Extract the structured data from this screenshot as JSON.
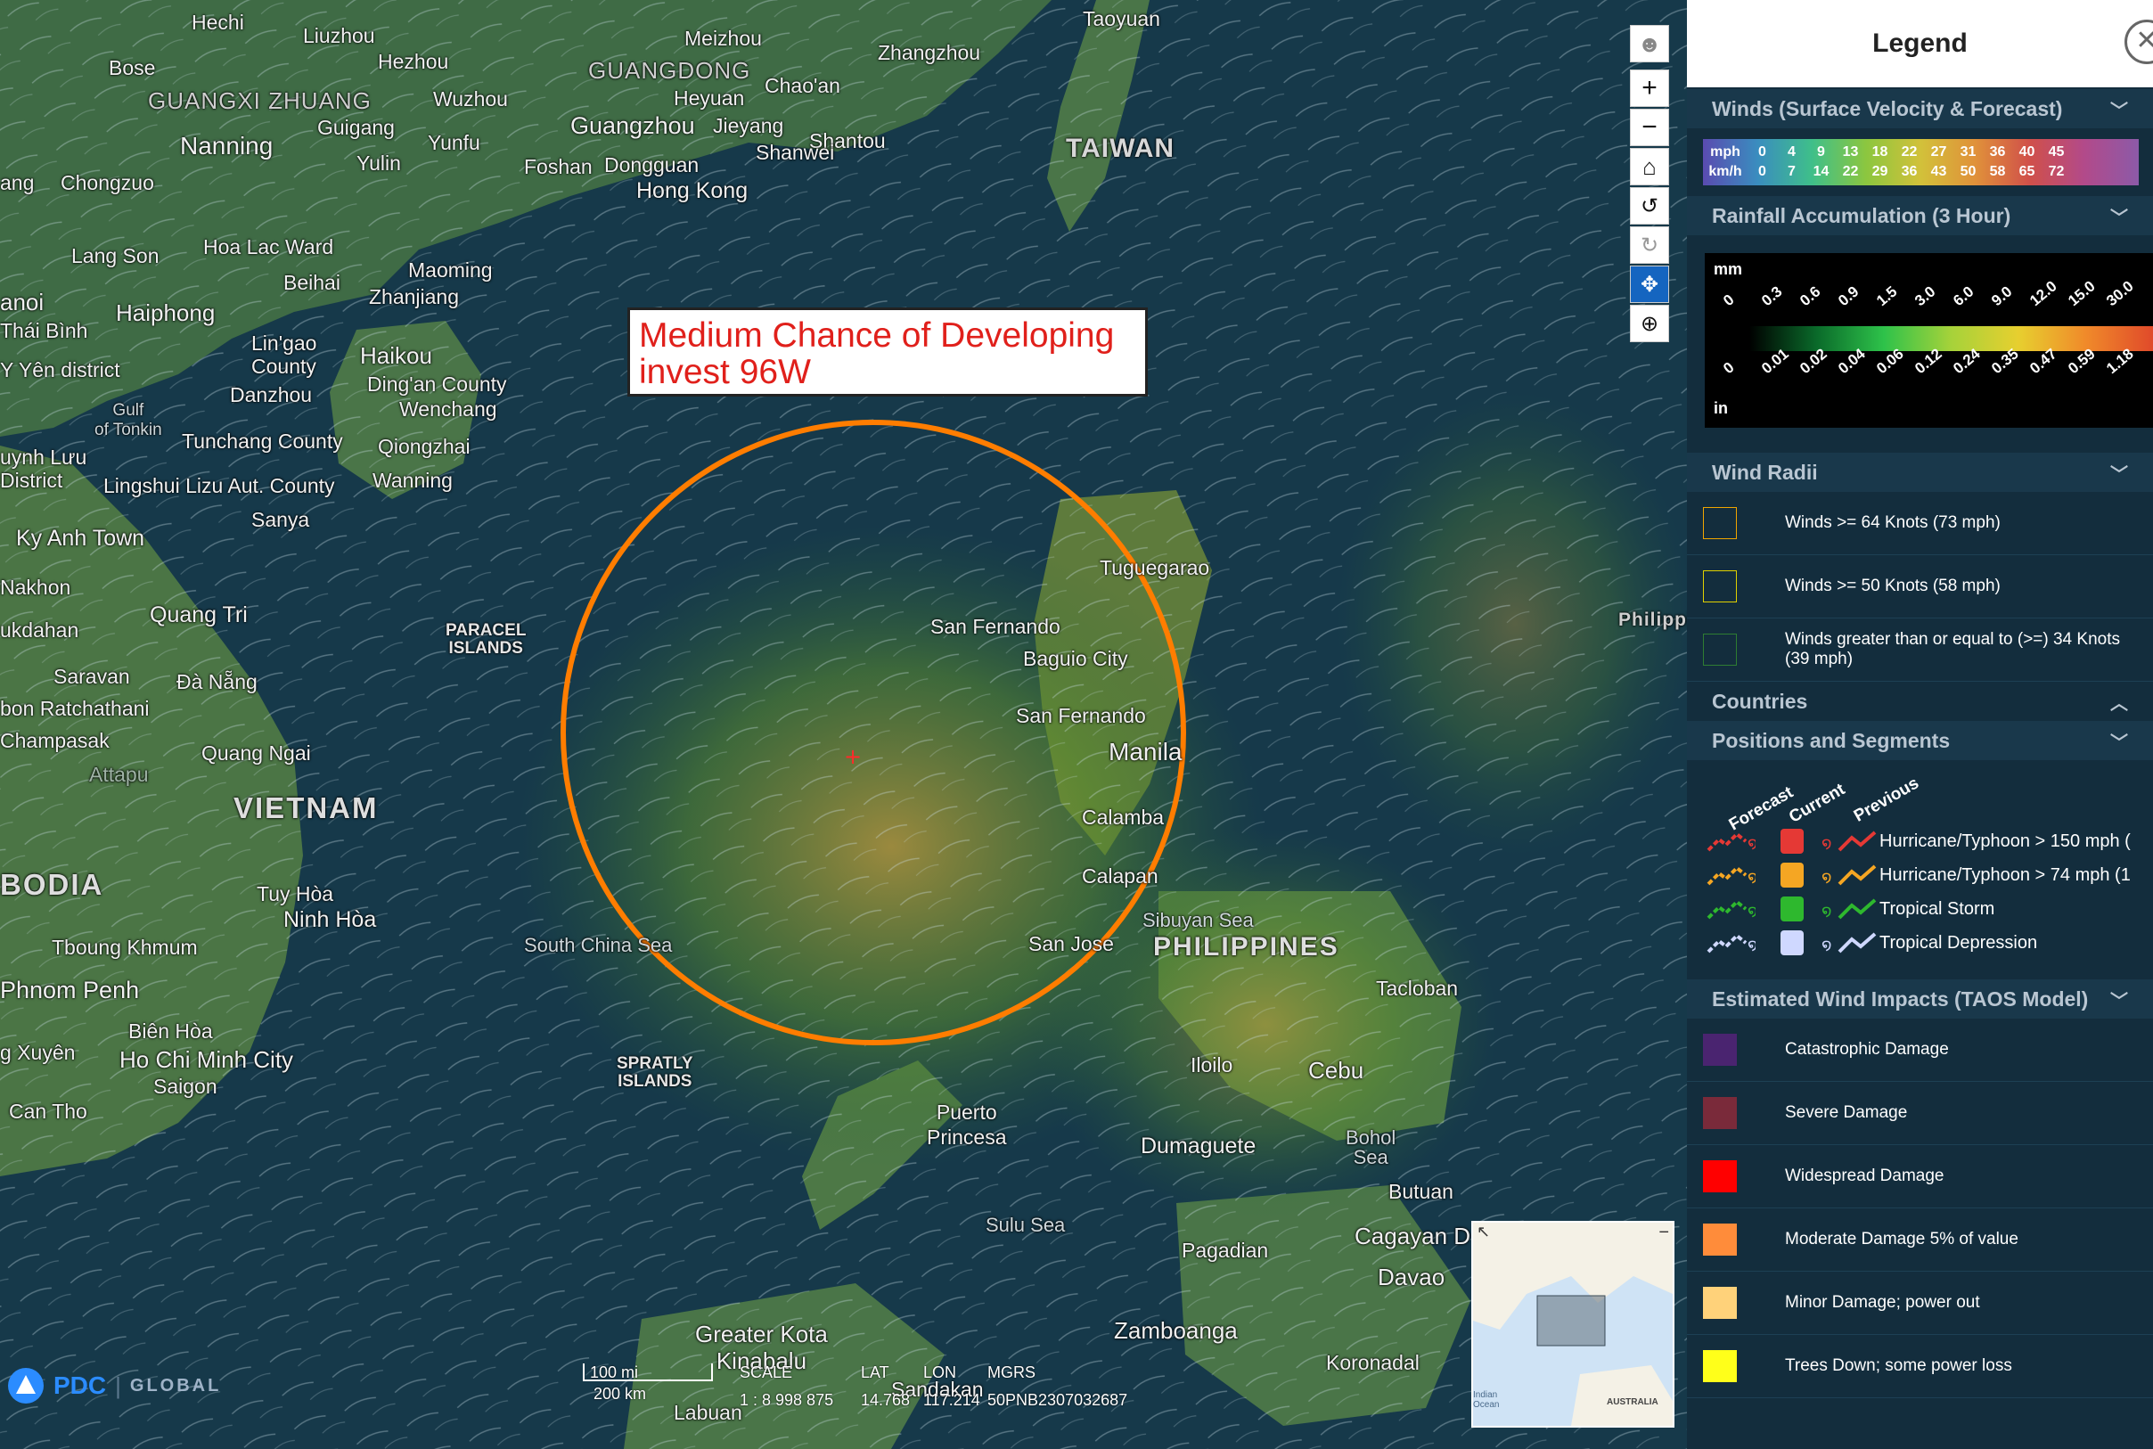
{
  "map": {
    "annotation": "Medium Chance of Developing\ninvest 96W",
    "labels": {
      "hechi": "Hechi",
      "liuzhou": "Liuzhou",
      "meizhou": "Meizhou",
      "zhangzhou": "Zhangzhou",
      "taoyuan": "Taoyuan",
      "bose": "Bose",
      "hezhou": "Hezhou",
      "guangdong": "GUANGDONG",
      "guangxi": "GUANGXI ZHUANG",
      "wuzhou": "Wuzhou",
      "heyuan": "Heyuan",
      "chaoan": "Chao'an",
      "nanning": "Nanning",
      "guigang": "Guigang",
      "yunfu": "Yunfu",
      "guangzhou": "Guangzhou",
      "jieyang": "Jieyang",
      "shantou": "Shantou",
      "shanwei": "Shanwei",
      "yulin": "Yulin",
      "foshan": "Foshan",
      "dongguan": "Dongguan",
      "hongkong": "Hong Kong",
      "taiwan": "TAIWAN",
      "chongzuo": "Chongzuo",
      "ang": "ang",
      "langson": "Lang Son",
      "hoalac": "Hoa Lac Ward",
      "beihai": "Beihai",
      "maoming": "Maoming",
      "zhanjiang": "Zhanjiang",
      "hanoi": "anoi",
      "haiphong": "Haiphong",
      "thaibinh": "Thái Bình",
      "lingao": "Lin'gao\nCounty",
      "haikou": "Haikou",
      "yenen": "Y Yên district",
      "danzhou": "Danzhou",
      "dingan": "Ding'an County",
      "wenchang": "Wenchang",
      "gulf": "Gulf\nof Tonkin",
      "tunchang": "Tunchang County",
      "qiongzhai": "Qiongzhai",
      "luu": "uynh Lưu\nDistrict",
      "lingshui": "Lingshui Lizu Aut. County",
      "wanning": "Wanning",
      "sanya": "Sanya",
      "kyanh": "Ky Anh Town",
      "nakhon": "Nakhon",
      "quangtri": "Quang Tri",
      "paracel": "PARACEL\nISLANDS",
      "mukdahan": "ukdahan",
      "savan": "Saravan",
      "danang": "Đà Nẵng",
      "ratchathani": "bon Ratchathani",
      "champasak": "Champasak",
      "quangngai": "Quang Ngai",
      "attapu": "Attapu",
      "vietnam": "VIETNAM",
      "cambodia": "BODIA",
      "tuyhoa": "Tuy Hòa",
      "ninhhoa": "Ninh Hòa",
      "tboung": "Tboung Khmum",
      "phnompenh": "Phnom Penh",
      "bienhoa": "Biên Hòa",
      "hcmc": "Ho Chi Minh City",
      "saigon": "Saigon",
      "xuyen": "g Xuyên",
      "cantho": "Can Tho",
      "southchinasea": "South China Sea",
      "spratly": "SPRATLY\nISLANDS",
      "tuguegarao": "Tuguegarao",
      "sanfernando1": "San Fernando",
      "baguio": "Baguio City",
      "sanfernando2": "San Fernando",
      "manila": "Manila",
      "calamba": "Calamba",
      "calapan": "Calapan",
      "sibuyan": "Sibuyan Sea",
      "philippines": "PHILIPPINES",
      "philippi": "Philippi",
      "sanjose": "San Jose",
      "tacloban": "Tacloban",
      "iloilo": "Iloilo",
      "cebu": "Cebu",
      "puerto": "Puerto\nPrincesa",
      "dumaguete": "Dumaguete",
      "bohol": "Bohol\nSea",
      "butuan": "Butuan",
      "cagayan": "Cagayan D",
      "sulusea": "Sulu Sea",
      "pagadian": "Pagadian",
      "davao": "Davao",
      "zamboanga": "Zamboanga",
      "greaterkota": "Greater Kota\nKinabalu",
      "sandakan": "Sandakan",
      "koronadal": "Koronadal",
      "labuan": "Labuan"
    },
    "scale": {
      "mi": "100 mi",
      "km": "200 km"
    },
    "coord": {
      "headers": [
        "SCALE",
        "LAT",
        "LON",
        "MGRS"
      ],
      "values": [
        "1 : 8 998 875",
        "14.768",
        "117.214",
        "50PNB2307032687"
      ]
    },
    "logo": {
      "pdc": "PDC",
      "global": "GLOBAL"
    },
    "inset": {
      "ocean": "Indian\nOcean",
      "australia": "AUSTRALIA"
    }
  },
  "legend": {
    "title": "Legend",
    "sections": {
      "winds": "Winds (Surface Velocity & Forecast)",
      "rain": "Rainfall Accumulation (3 Hour)",
      "radii": "Wind Radii",
      "countries": "Countries",
      "positions": "Positions and Segments",
      "impacts": "Estimated Wind Impacts (TAOS Model)"
    },
    "wind_table": {
      "mph_label": "mph",
      "kmh_label": "km/h",
      "mph": [
        "0",
        "4",
        "9",
        "13",
        "18",
        "22",
        "27",
        "31",
        "36",
        "40",
        "45"
      ],
      "kmh": [
        "0",
        "7",
        "14",
        "22",
        "29",
        "36",
        "43",
        "50",
        "58",
        "65",
        "72"
      ]
    },
    "rain": {
      "mm_label": "mm",
      "in_label": "in",
      "mm": [
        "0",
        "0.3",
        "0.6",
        "0.9",
        "1.5",
        "3.0",
        "6.0",
        "9.0",
        "12.0",
        "15.0",
        "30.0"
      ],
      "in": [
        "0",
        "0.01",
        "0.02",
        "0.04",
        "0.06",
        "0.12",
        "0.24",
        "0.35",
        "0.47",
        "0.59",
        "1.18"
      ]
    },
    "radii": [
      {
        "label": "Winds >= 64 Knots (73 mph)",
        "color": "#f0a500"
      },
      {
        "label": "Winds >= 50 Knots (58 mph)",
        "color": "#e0d000"
      },
      {
        "label": "Winds greater than or equal to (>=) 34 Knots (39 mph)",
        "color": "#2e7d32"
      }
    ],
    "positions": {
      "headers": [
        "Forecast",
        "Current",
        "Previous"
      ],
      "rows": [
        {
          "label": "Hurricane/Typhoon > 150 mph (",
          "color": "#e53935"
        },
        {
          "label": "Hurricane/Typhoon > 74 mph (1",
          "color": "#f5a623"
        },
        {
          "label": "Tropical Storm",
          "color": "#2eb82e"
        },
        {
          "label": "Tropical Depression",
          "color": "#cfd8ff"
        }
      ]
    },
    "impacts": [
      {
        "label": "Catastrophic Damage",
        "color": "#4a2470"
      },
      {
        "label": "Severe Damage",
        "color": "#7a2a3a"
      },
      {
        "label": "Widespread Damage",
        "color": "#ff0000"
      },
      {
        "label": "Moderate Damage 5% of value",
        "color": "#ff8c3a"
      },
      {
        "label": "Minor Damage; power out",
        "color": "#ffd27a"
      },
      {
        "label": "Trees Down; some power loss",
        "color": "#ffff1a"
      }
    ]
  }
}
